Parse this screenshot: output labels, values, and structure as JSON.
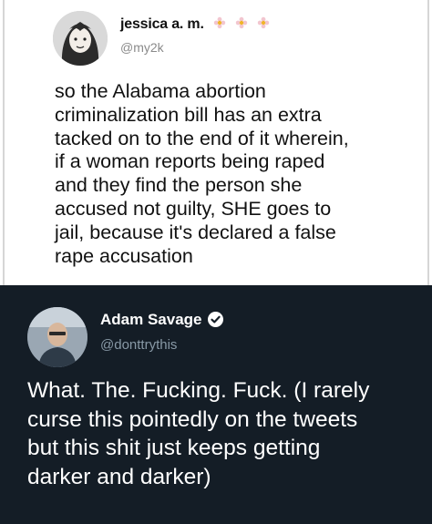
{
  "tweet1": {
    "name": "jessica a. m.",
    "name_emoji": [
      "flower-icon",
      "flower-icon",
      "flower-icon"
    ],
    "handle": "@my2k",
    "lines": [
      "so the Alabama abortion",
      "criminalization bill has an extra",
      "tacked on to the end of it wherein,",
      "if a woman reports being raped",
      "and they find the person she",
      "accused not guilty, SHE goes to",
      "jail, because it's declared a false",
      "rape accusation"
    ]
  },
  "tweet2": {
    "name": "Adam Savage",
    "handle": "@donttrythis",
    "lines": [
      "What. The. Fucking. Fuck. (I rarely",
      "curse this pointedly on the tweets",
      "but this shit just keeps getting",
      "darker and darker)"
    ]
  },
  "colors": {
    "light_bg": "#ffffff",
    "dark_bg": "#141d26",
    "muted_light": "#8a8a8a",
    "muted_dark": "#8899a6"
  }
}
